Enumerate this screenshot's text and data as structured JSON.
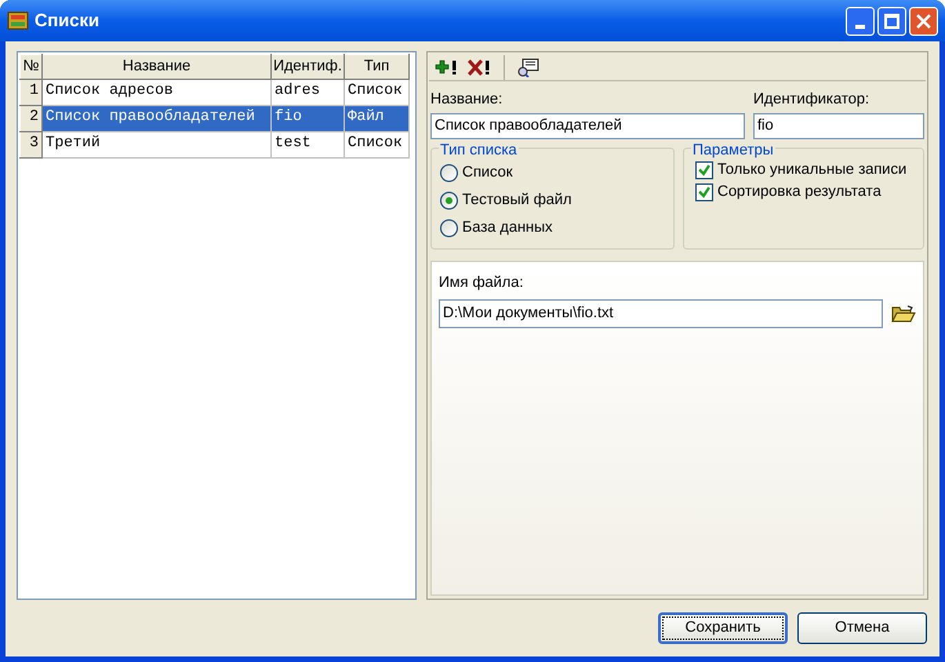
{
  "window": {
    "title": "Списки"
  },
  "table": {
    "columns": [
      "№",
      "Название",
      "Идентиф.",
      "Тип"
    ],
    "rows": [
      {
        "cells": [
          "1",
          "Список адресов",
          "adres",
          "Список"
        ],
        "selected": false
      },
      {
        "cells": [
          "2",
          "Список правообладателей",
          "fio",
          "Файл"
        ],
        "selected": true
      },
      {
        "cells": [
          "3",
          "Третий",
          "test",
          "Список"
        ],
        "selected": false
      }
    ]
  },
  "form": {
    "name_label": "Название:",
    "name_value": "Список правообладателей",
    "id_label": "Идентификатор:",
    "id_value": "fio",
    "list_type": {
      "title": "Тип списка",
      "options": [
        {
          "label": "Список",
          "selected": false
        },
        {
          "label": "Тестовый файл",
          "selected": true
        },
        {
          "label": "База данных",
          "selected": false
        }
      ]
    },
    "params": {
      "title": "Параметры",
      "options": [
        {
          "label": "Только уникальные записи",
          "checked": true
        },
        {
          "label": "Сортировка результата",
          "checked": true
        }
      ]
    },
    "file": {
      "label": "Имя файла:",
      "value": "D:\\Мои документы\\fio.txt"
    }
  },
  "buttons": [
    {
      "label": "Сохранить",
      "default": true
    },
    {
      "label": "Отмена",
      "default": false
    }
  ]
}
